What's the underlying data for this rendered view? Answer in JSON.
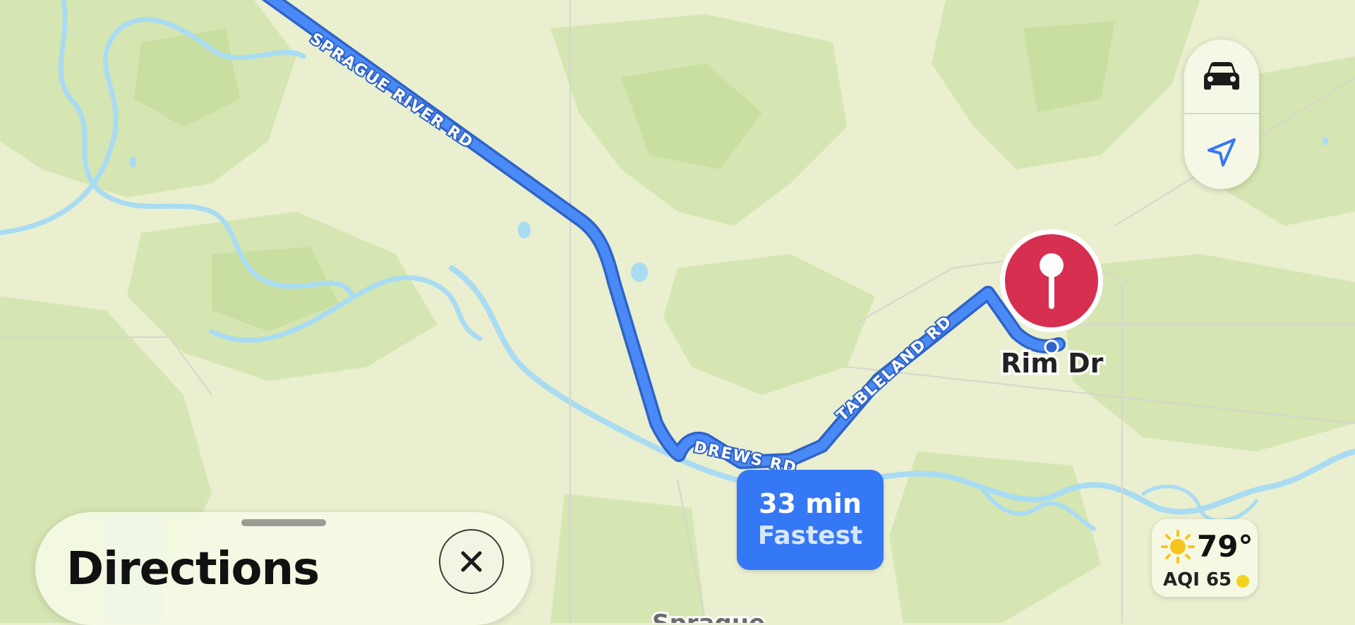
{
  "map": {
    "roads": {
      "sprague_river_rd": "SPRAGUE RIVER RD",
      "drews_rd": "DREWS RD",
      "tableland_rd": "TABLELAND RD"
    },
    "destination_label": "Rim Dr",
    "town_label": "Sprague",
    "route_color": "#3478f6",
    "pin_color": "#d62f4f",
    "river_color": "#a9dcf3"
  },
  "controls": {
    "drive_mode_icon": "car-icon",
    "locate_icon": "location-arrow-icon"
  },
  "route": {
    "time": "33 min",
    "label": "Fastest"
  },
  "panel": {
    "title": "Directions",
    "close_icon": "close-icon"
  },
  "weather": {
    "icon": "sun-icon",
    "temperature": "79°",
    "aqi": "AQI 65",
    "aqi_color": "#f3d21f"
  }
}
